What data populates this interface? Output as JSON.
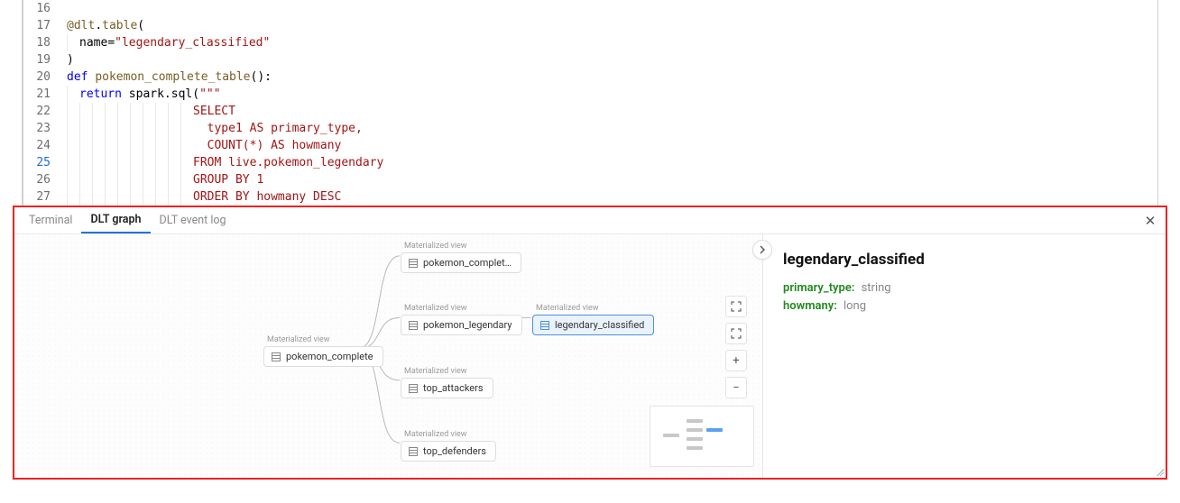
{
  "editor": {
    "lines": [
      {
        "n": 16,
        "tokens": []
      },
      {
        "n": 17,
        "tokens": [
          {
            "t": "@dlt",
            "c": "tok-decor"
          },
          {
            "t": ".",
            "c": "tok-default"
          },
          {
            "t": "table",
            "c": "tok-decor"
          },
          {
            "t": "(",
            "c": "tok-paren"
          }
        ]
      },
      {
        "n": 18,
        "indents": 1,
        "tokens": [
          {
            "t": "name",
            "c": "tok-default"
          },
          {
            "t": "=",
            "c": "tok-default"
          },
          {
            "t": "\"legendary_classified\"",
            "c": "tok-str"
          }
        ]
      },
      {
        "n": 19,
        "tokens": [
          {
            "t": ")",
            "c": "tok-paren"
          }
        ]
      },
      {
        "n": 20,
        "tokens": [
          {
            "t": "def ",
            "c": "tok-kw"
          },
          {
            "t": "pokemon_complete_table",
            "c": "tok-func"
          },
          {
            "t": "():",
            "c": "tok-default"
          }
        ]
      },
      {
        "n": 21,
        "indents": 1,
        "tokens": [
          {
            "t": "return ",
            "c": "tok-kw"
          },
          {
            "t": "spark.sql(",
            "c": "tok-default"
          },
          {
            "t": "\"\"\"",
            "c": "tok-str"
          }
        ]
      },
      {
        "n": 22,
        "indents": 10,
        "tokens": [
          {
            "t": "SELECT",
            "c": "tok-str"
          }
        ]
      },
      {
        "n": 23,
        "indents": 10,
        "tokens": [
          {
            "t": "  type1 AS primary_type,",
            "c": "tok-str"
          }
        ]
      },
      {
        "n": 24,
        "indents": 10,
        "tokens": [
          {
            "t": "  COUNT(*) AS howmany",
            "c": "tok-str"
          }
        ]
      },
      {
        "n": 25,
        "active": true,
        "indents": 10,
        "tokens": [
          {
            "t": "FROM live.pokemon_legendary",
            "c": "tok-str"
          }
        ]
      },
      {
        "n": 26,
        "indents": 10,
        "tokens": [
          {
            "t": "GROUP BY 1",
            "c": "tok-str"
          }
        ]
      },
      {
        "n": 27,
        "indents": 10,
        "tokens": [
          {
            "t": "ORDER BY howmany DESC",
            "c": "tok-str"
          }
        ]
      }
    ]
  },
  "panel": {
    "tabs": {
      "terminal": "Terminal",
      "graph": "DLT graph",
      "eventlog": "DLT event log"
    },
    "details": {
      "title": "legendary_classified",
      "schema": [
        {
          "name": "primary_type:",
          "type": "string"
        },
        {
          "name": "howmany:",
          "type": "long"
        }
      ]
    },
    "nodes": {
      "root": {
        "label": "Materialized view",
        "name": "pokemon_complete"
      },
      "complet": {
        "label": "Materialized view",
        "name": "pokemon_complet…"
      },
      "legendary": {
        "label": "Materialized view",
        "name": "pokemon_legendary"
      },
      "classified": {
        "label": "Materialized view",
        "name": "legendary_classified"
      },
      "attackers": {
        "label": "Materialized view",
        "name": "top_attackers"
      },
      "defenders": {
        "label": "Materialized view",
        "name": "top_defenders"
      }
    }
  }
}
